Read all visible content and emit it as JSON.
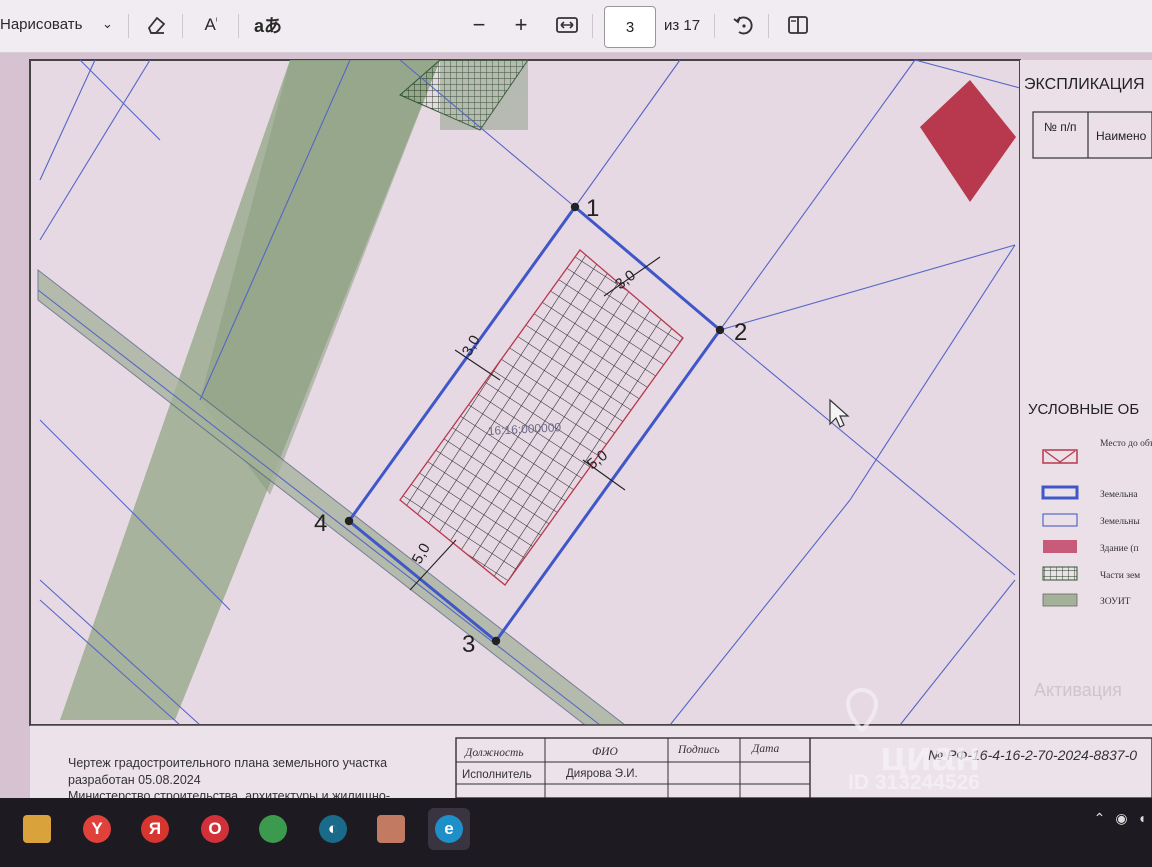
{
  "toolbar": {
    "draw_label": "Нарисовать",
    "draw_icon": "chevron-down-icon",
    "eraser_icon": "eraser-icon",
    "read_aloud_icon": "read-aloud-icon",
    "translate_glyph": "aあ",
    "zoom_out": "−",
    "zoom_in": "+",
    "fit_icon": "fit-to-width-icon",
    "current_page": "3",
    "total_pages": "из 17",
    "rotate_icon": "rotate-icon",
    "page_view_icon": "page-view-icon"
  },
  "drawing": {
    "points": [
      "1",
      "2",
      "3",
      "4"
    ],
    "setbacks": [
      "3,0",
      "3,0",
      "5,0",
      "5,0"
    ],
    "building_label": "16:16:000000",
    "explication": {
      "title": "ЭКСПЛИКАЦИЯ",
      "col_no": "№ п/п",
      "col_name": "Наимено"
    },
    "legend": {
      "title": "УСЛОВНЫЕ ОБ",
      "items": [
        "Место до объекта к строител",
        "Земельна",
        "Земельны",
        "Здание (п",
        "Части зем",
        "ЗОУИТ"
      ]
    },
    "footer": {
      "note_line1": "Чертеж градостроительного плана земельного участка",
      "note_line2": "разработан 05.08.2024",
      "note_line3": "Министерство строительства, архитектуры и жилищно-",
      "table_headers": [
        "Должность",
        "ФИО",
        "Подпись",
        "Дата"
      ],
      "row_role": "Исполнитель",
      "row_name": "Диярова Э.И.",
      "doc_number": "№ РФ-16-4-16-2-70-2024-8837-0"
    },
    "watermark": {
      "brand": "циан",
      "id": "ID 313244526",
      "activation": "Активация"
    },
    "colors": {
      "paper": "#e5d6e1",
      "zouit_green": "#95a88a",
      "building_red": "#b8394d",
      "boundary_blue": "#3f57c8",
      "parcel_line": "#5868c4"
    }
  },
  "taskbar": {
    "apps": [
      {
        "icon": "file-manager-icon",
        "color": "#d9a23a",
        "glyph": ""
      },
      {
        "icon": "yandex-browser-icon",
        "color": "#e0413a",
        "glyph": "Y"
      },
      {
        "icon": "yandex-icon",
        "color": "#d6362f",
        "glyph": "Я"
      },
      {
        "icon": "opera-icon",
        "color": "#d2313a",
        "glyph": "O"
      },
      {
        "icon": "chrome-icon",
        "color": "#3c9a4e",
        "glyph": ""
      },
      {
        "icon": "app-icon",
        "color": "#1a6b8a",
        "glyph": "◐"
      },
      {
        "icon": "photo-app-icon",
        "color": "#c27a62",
        "glyph": ""
      },
      {
        "icon": "edge-icon",
        "color": "#1f8fc9",
        "glyph": "e"
      }
    ],
    "tray": [
      "chevron-up-icon",
      "network-icon",
      "volume-icon"
    ]
  }
}
